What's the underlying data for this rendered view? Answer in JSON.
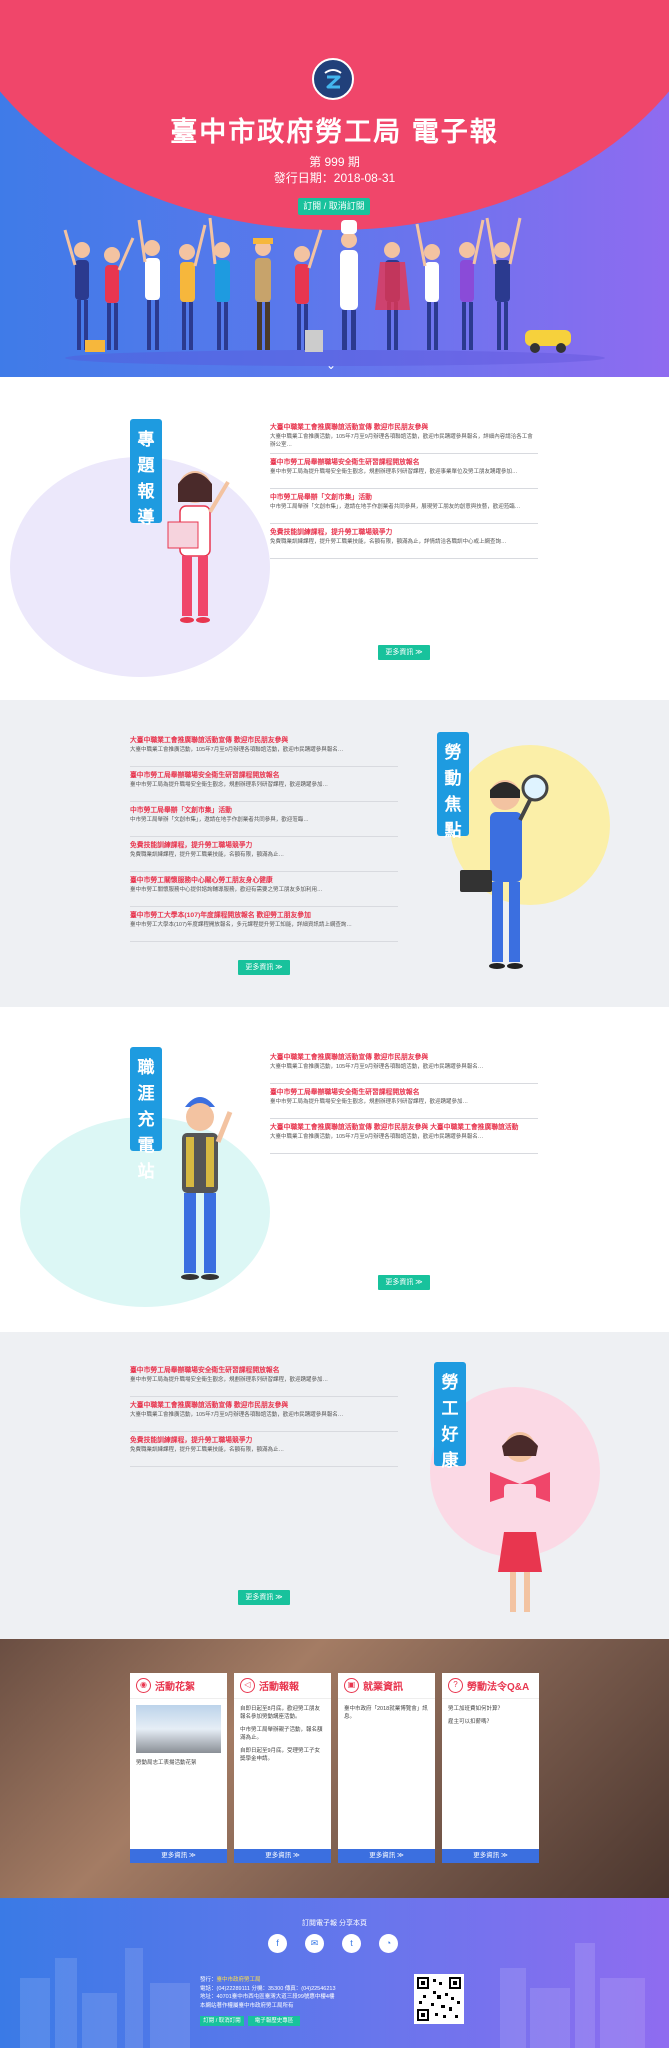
{
  "hero": {
    "title": "臺中市政府勞工局 電子報",
    "issue": "第 999 期",
    "date": "發行日期：2018-08-31",
    "subscribe_label": "訂閱 / 取消訂閱",
    "colors": {
      "arc": "#f0466a",
      "bg_left": "#3f7be8",
      "bg_right": "#8f6bf0"
    }
  },
  "sections": [
    {
      "tag": "專題報導",
      "more_label": "更多資訊 ≫",
      "items": [
        {
          "title": "大臺中職業工會推廣聯誼活動宣傳 歡迎市民朋友參與",
          "desc": "大臺中職業工會推廣活動，105年7月至9月辦理各項聯誼活動，歡迎市民踴躍參與報名，詳細內容請洽各工會辦公室…"
        },
        {
          "title": "臺中市勞工局舉辦職場安全衛生研習課程開放報名",
          "desc": "臺中市勞工局為提升職場安全衛生觀念，規劃辦理系列研習課程，歡迎事業單位及勞工朋友踴躍參加…"
        },
        {
          "title": "中市勞工局舉辦「文創市集」活動",
          "desc": "中市勞工局舉辦「文創市集」，邀請在地手作創業者共同參與，展現勞工朋友的創意與技藝，歡迎蒞臨…"
        },
        {
          "title": "免費技能訓練課程，提升勞工職場競爭力",
          "desc": "免費職業訓練課程，提升勞工職業技能，名額有限，額滿為止，詳情請洽各職訓中心或上網查詢…"
        }
      ]
    },
    {
      "tag": "勞動焦點",
      "more_label": "更多資訊 ≫",
      "items": [
        {
          "title": "大臺中職業工會推廣聯誼活動宣傳 歡迎市民朋友參與",
          "desc": "大臺中職業工會推廣活動，105年7月至9月辦理各項聯誼活動，歡迎市民踴躍參與報名…"
        },
        {
          "title": "臺中市勞工局舉辦職場安全衛生研習課程開放報名",
          "desc": "臺中市勞工局為提升職場安全衛生觀念，規劃辦理系列研習課程，歡迎踴躍參加…"
        },
        {
          "title": "中市勞工局舉辦「文創市集」活動",
          "desc": "中市勞工局舉辦「文創市集」，邀請在地手作創業者共同參與，歡迎蒞臨…"
        },
        {
          "title": "免費技能訓練課程，提升勞工職場競爭力",
          "desc": "免費職業訓練課程，提升勞工職業技能，名額有限，額滿為止…"
        },
        {
          "title": "臺中市勞工關懷服務中心關心勞工朋友身心健康",
          "desc": "臺中市勞工關懷服務中心提供諮詢輔導服務，歡迎有需要之勞工朋友多加利用…"
        },
        {
          "title": "臺中市勞工大學本(107)年度課程開放報名 歡迎勞工朋友參加",
          "desc": "臺中市勞工大學本(107)年度課程開放報名，多元課程提升勞工知能，詳細資訊請上網查詢…"
        }
      ]
    },
    {
      "tag": "職涯充電站",
      "more_label": "更多資訊 ≫",
      "items": [
        {
          "title": "大臺中職業工會推廣聯誼活動宣傳 歡迎市民朋友參與",
          "desc": "大臺中職業工會推廣活動，105年7月至9月辦理各項聯誼活動，歡迎市民踴躍參與報名…"
        },
        {
          "title": "臺中市勞工局舉辦職場安全衛生研習課程開放報名",
          "desc": "臺中市勞工局為提升職場安全衛生觀念，規劃辦理系列研習課程，歡迎踴躍參加…"
        },
        {
          "title": "大臺中職業工會推廣聯誼活動宣傳 歡迎市民朋友參與 大臺中職業工會推廣聯誼活動",
          "desc": "大臺中職業工會推廣活動，105年7月至9月辦理各項聯誼活動，歡迎市民踴躍參與報名…"
        }
      ]
    },
    {
      "tag": "勞工好康",
      "more_label": "更多資訊 ≫",
      "items": [
        {
          "title": "臺中市勞工局舉辦職場安全衛生研習課程開放報名",
          "desc": "臺中市勞工局為提升職場安全衛生觀念，規劃辦理系列研習課程，歡迎踴躍參加…"
        },
        {
          "title": "大臺中職業工會推廣聯誼活動宣傳 歡迎市民朋友參與",
          "desc": "大臺中職業工會推廣活動，105年7月至9月辦理各項聯誼活動，歡迎市民踴躍參與報名…"
        },
        {
          "title": "免費技能訓練課程，提升勞工職場競爭力",
          "desc": "免費職業訓練課程，提升勞工職業技能，名額有限，額滿為止…"
        }
      ]
    }
  ],
  "cards": [
    {
      "title": "活動花絮",
      "icon": "camera-icon",
      "body": [
        "勞動局志工表揚活動花絮"
      ],
      "more_label": "更多資訊 ≫"
    },
    {
      "title": "活動報報",
      "icon": "megaphone-icon",
      "body": [
        "自即日起至8月底，歡迎勞工朋友報名參加勞動講座活動。",
        "中市勞工局舉辦親子活動，報名額滿為止。",
        "自即日起至9月底，受理勞工子女獎學金申請。"
      ],
      "more_label": "更多資訊 ≫"
    },
    {
      "title": "就業資訊",
      "icon": "briefcase-icon",
      "body": [
        "臺中市政府「2018就業博覽會」訊息。"
      ],
      "more_label": "更多資訊 ≫"
    },
    {
      "title": "勞動法令Q&A",
      "icon": "question-icon",
      "body": [
        "勞工加班費如何計算？",
        "雇主可以扣薪嗎？"
      ],
      "more_label": "更多資訊 ≫"
    }
  ],
  "footer": {
    "title": "訂閱電子報 分享本頁",
    "social_icons": [
      "facebook-icon",
      "email-icon",
      "twitter-icon",
      "line-icon"
    ],
    "publisher_label": "發行：",
    "publisher": "臺中市政府勞工局",
    "phone": "電話：(04)22289111 分機：35300 傳真：(04)22546213",
    "address": "地址：40701臺中市西屯區臺灣大道三段99號惠中樓4樓",
    "copyright": "本網站著作權屬臺中市政府勞工局所有",
    "btn1": "訂閱 / 取消訂閱",
    "btn2": "電子報歷史專區"
  }
}
